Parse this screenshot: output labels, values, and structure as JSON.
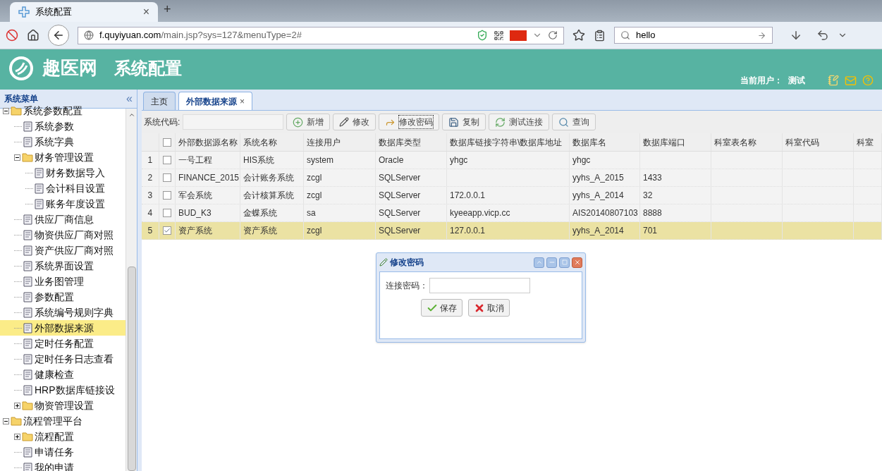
{
  "browser": {
    "tab": {
      "title": "系统配置",
      "close": "×"
    },
    "new_tab": "+",
    "url": {
      "host": "f.quyiyuan.com",
      "path": "/main.jsp?sys=127&menuType=2#"
    },
    "search": {
      "value": "hello"
    }
  },
  "header": {
    "logo": "趣医网",
    "title": "系统配置",
    "user_label": "当前用户：",
    "user": "测试"
  },
  "sidebar": {
    "title": "系统菜单",
    "collapse": "«",
    "items": [
      {
        "kind": "folder",
        "label": "系统参数配置",
        "expanded": true,
        "selected": false,
        "children": [
          {
            "kind": "file",
            "label": "系统参数",
            "selected": false
          },
          {
            "kind": "file",
            "label": "系统字典",
            "selected": false
          },
          {
            "kind": "folder",
            "label": "财务管理设置",
            "expanded": true,
            "selected": false,
            "children": [
              {
                "kind": "file",
                "label": "财务数据导入",
                "selected": false
              },
              {
                "kind": "file",
                "label": "会计科目设置",
                "selected": false
              },
              {
                "kind": "file",
                "label": "账务年度设置",
                "selected": false
              }
            ]
          },
          {
            "kind": "file",
            "label": "供应厂商信息",
            "selected": false
          },
          {
            "kind": "file",
            "label": "物资供应厂商对照",
            "selected": false
          },
          {
            "kind": "file",
            "label": "资产供应厂商对照",
            "selected": false
          },
          {
            "kind": "file",
            "label": "系统界面设置",
            "selected": false
          },
          {
            "kind": "file",
            "label": "业务图管理",
            "selected": false
          },
          {
            "kind": "file",
            "label": "参数配置",
            "selected": false
          },
          {
            "kind": "file",
            "label": "系统编号规则字典",
            "selected": false
          },
          {
            "kind": "file",
            "label": "外部数据来源",
            "selected": true
          },
          {
            "kind": "file",
            "label": "定时任务配置",
            "selected": false
          },
          {
            "kind": "file",
            "label": "定时任务日志查看",
            "selected": false
          },
          {
            "kind": "file",
            "label": "健康检查",
            "selected": false
          },
          {
            "kind": "file",
            "label": "HRP数据库链接设",
            "selected": false
          },
          {
            "kind": "folder",
            "label": "物资管理设置",
            "expanded": false,
            "selected": false
          }
        ]
      },
      {
        "kind": "folder",
        "label": "流程管理平台",
        "expanded": true,
        "selected": false,
        "children": [
          {
            "kind": "folder",
            "label": "流程配置",
            "expanded": false,
            "selected": false
          },
          {
            "kind": "file",
            "label": "申请任务",
            "selected": false
          },
          {
            "kind": "file",
            "label": "我的申请",
            "selected": false
          }
        ]
      }
    ]
  },
  "tabs": [
    {
      "label": "主页",
      "selected": false
    },
    {
      "label": "外部数据来源",
      "selected": true,
      "close": "×"
    }
  ],
  "toolbar": {
    "field_label": "系统代码:",
    "buttons": [
      {
        "label": "新增",
        "focused": false
      },
      {
        "label": "修改",
        "focused": false
      },
      {
        "label": "修改密码",
        "focused": true
      },
      {
        "label": "复制",
        "focused": false
      },
      {
        "label": "测试连接",
        "focused": false
      },
      {
        "label": "查询",
        "focused": false
      }
    ]
  },
  "table": {
    "header_checked": false,
    "columns": [
      "外部数据源名称",
      "系统名称",
      "连接用户",
      "数据库类型",
      "数据库链接字符串\\数据库地址",
      "数据库名",
      "数据库端口",
      "科室表名称",
      "科室代码",
      "科室"
    ],
    "rows": [
      {
        "number": "1",
        "checked": false,
        "selected": false,
        "cells": [
          "一号工程",
          "HIS系统",
          "system",
          "Oracle",
          "yhgc",
          "yhgc",
          "",
          "",
          "",
          ""
        ]
      },
      {
        "number": "2",
        "checked": false,
        "selected": false,
        "cells": [
          "FINANCE_2015",
          "会计账务系统",
          "zcgl",
          "SQLServer",
          "",
          "yyhs_A_2015",
          "1433",
          "",
          "",
          ""
        ]
      },
      {
        "number": "3",
        "checked": false,
        "selected": false,
        "cells": [
          "军会系统",
          "会计核算系统",
          "zcgl",
          "SQLServer",
          "172.0.0.1",
          "yyhs_A_2014",
          "32",
          "",
          "",
          ""
        ]
      },
      {
        "number": "4",
        "checked": false,
        "selected": false,
        "cells": [
          "BUD_K3",
          "金蝶系统",
          "sa",
          "SQLServer",
          "kyeeapp.vicp.cc",
          "AIS20140807103",
          "8888",
          "",
          "",
          ""
        ]
      },
      {
        "number": "5",
        "checked": true,
        "selected": true,
        "cells": [
          "资产系统",
          "资产系统",
          "zcgl",
          "SQLServer",
          "127.0.0.1",
          "yyhs_A_2014",
          "701",
          "",
          "",
          ""
        ]
      }
    ]
  },
  "dialog": {
    "title": "修改密码",
    "field_label": "连接密码：",
    "buttons": [
      {
        "kind": "save",
        "label": "保存"
      },
      {
        "kind": "cancel",
        "label": "取消"
      }
    ]
  }
}
